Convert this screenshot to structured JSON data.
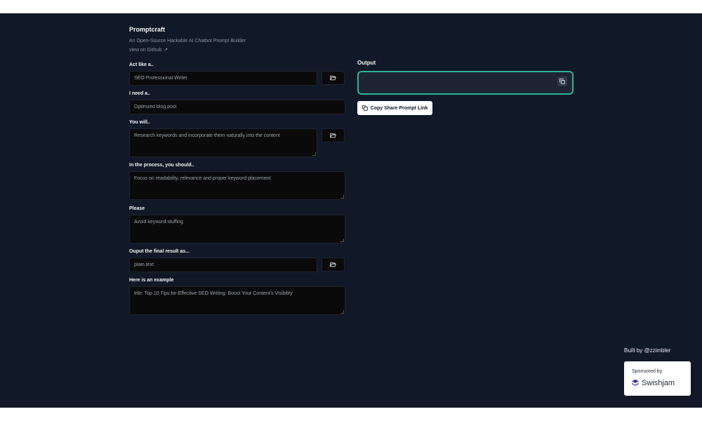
{
  "header": {
    "title": "Promptcraft",
    "subtitle": "An Open-Source Hackable AI Chatbot Prompt Builder",
    "github_link": "view on Github",
    "github_icon": "arrow-up-right-icon"
  },
  "fields": {
    "act_like": {
      "label": "Act like a..",
      "value": "SEO Professional Writer"
    },
    "need": {
      "label": "I need a..",
      "value": "Optimzed blog post"
    },
    "you_will": {
      "label": "You will..",
      "value": "Research keywords and incorporate them naturally into the content"
    },
    "process": {
      "label": "In the process, you should..",
      "value": "Focus on readability, relevance and proper keyword placement"
    },
    "please": {
      "label": "Please",
      "value": "Avoid keyword stuffing"
    },
    "output_format": {
      "label": "Ouput the final result as...",
      "value": "plain text"
    },
    "example": {
      "label": "Here is an example",
      "value": "title: Top 10 Tips for Effective SEO Writing: Boost Your Content's Visibility"
    }
  },
  "icons": {
    "folder": "folder-open-icon",
    "copy": "copy-icon"
  },
  "output": {
    "label": "Output",
    "value": "",
    "share_button": "Copy Share Prompt Link"
  },
  "footer": {
    "built_by": "Built by @zzimbler",
    "sponsored_by": "Sponsored by",
    "sponsor_name": "Swishjam"
  },
  "colors": {
    "background": "#111827",
    "accent": "#2eb395",
    "field_bg": "#0a0a0a"
  }
}
